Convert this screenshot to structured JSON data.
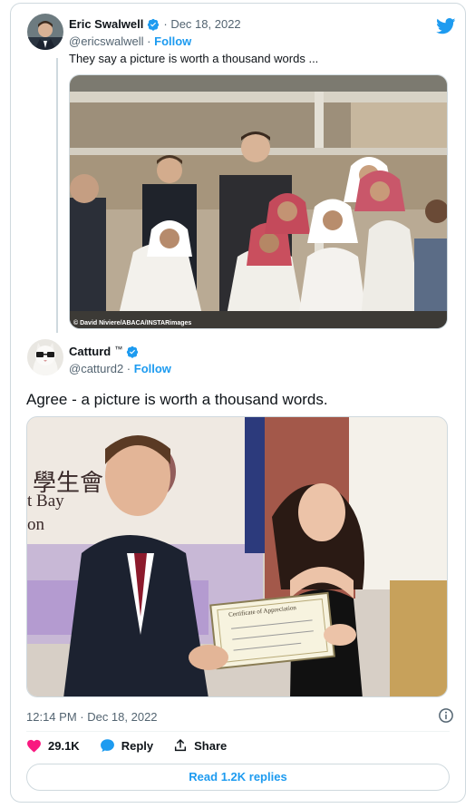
{
  "quoted_tweet": {
    "author_name": "Eric Swalwell",
    "date": "· Dec 18, 2022",
    "handle": "@ericswalwell ·",
    "follow_label": "Follow",
    "text": "They say a picture is worth a thousand words ...",
    "photo_credit": "© David Niviere/ABACA/INSTARimages"
  },
  "reply_tweet": {
    "author_name": "Catturd",
    "trademark": "™",
    "handle": "@catturd2 ·",
    "follow_label": "Follow",
    "text": "Agree - a picture is worth a thousand words.",
    "photo_sign_text_1": "t Bay",
    "photo_sign_text_2": "on",
    "photo_chinese_text": "學生會",
    "certificate_title": "Certificate of Appreciation"
  },
  "footer": {
    "timestamp": "12:14 PM · Dec 18, 2022",
    "likes": "29.1K",
    "reply_label": "Reply",
    "share_label": "Share",
    "read_replies": "Read 1.2K replies"
  },
  "colors": {
    "brand_blue": "#1d9bf0",
    "like_pink": "#f91880",
    "secondary_text": "#536471",
    "border": "#cfd9de"
  },
  "icons": [
    "twitter-bird-icon",
    "verified-badge-icon",
    "info-icon",
    "heart-icon",
    "reply-bubble-icon",
    "share-icon"
  ]
}
